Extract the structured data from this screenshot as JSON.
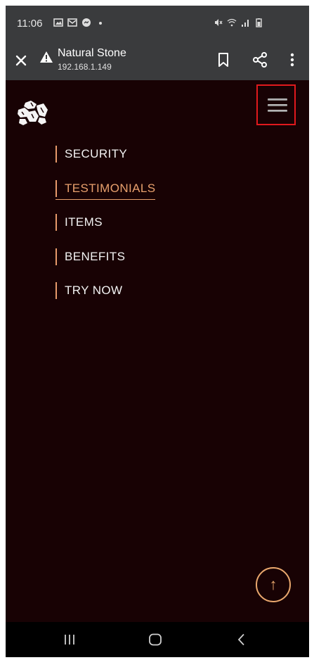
{
  "status_bar": {
    "time": "11:06",
    "left_icons": [
      "image-icon",
      "mail-icon",
      "messenger-icon",
      "dot-icon"
    ],
    "right_icons": [
      "mute-icon",
      "wifi-icon",
      "signal-icon",
      "battery-icon"
    ]
  },
  "browser": {
    "site_title": "Natural Stone",
    "url": "192.168.1.149",
    "icons": [
      "close-icon",
      "warning-icon",
      "bookmark-icon",
      "share-icon",
      "more-vert-icon"
    ]
  },
  "page": {
    "logo_icon": "stones-logo-icon",
    "menu_icon": "hamburger-icon",
    "nav_items": [
      "SECURITY",
      "TESTIMONIALS",
      "ITEMS",
      "BENEFITS",
      "TRY NOW"
    ],
    "active_nav": "TESTIMONIALS",
    "scroll_top_glyph": "↑",
    "colors": {
      "background": "#180204",
      "accent": "#e8a06d",
      "highlight_box": "#e0191d"
    }
  },
  "system_nav": {
    "icons": [
      "recents-icon",
      "home-icon",
      "back-icon"
    ]
  }
}
